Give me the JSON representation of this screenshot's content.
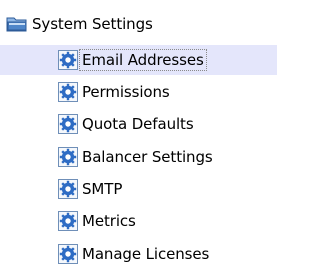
{
  "tree": {
    "root": {
      "label": "System Settings",
      "icon": "folder-icon"
    },
    "selected_index": 0,
    "items": [
      {
        "label": "Email Addresses",
        "icon": "settings-gear-icon"
      },
      {
        "label": "Permissions",
        "icon": "settings-gear-icon"
      },
      {
        "label": "Quota Defaults",
        "icon": "settings-gear-icon"
      },
      {
        "label": "Balancer Settings",
        "icon": "settings-gear-icon"
      },
      {
        "label": "SMTP",
        "icon": "settings-gear-icon"
      },
      {
        "label": "Metrics",
        "icon": "settings-gear-icon"
      },
      {
        "label": "Manage Licenses",
        "icon": "settings-gear-icon"
      }
    ],
    "colors": {
      "selected_background": "#e4e6fb",
      "icon_blue": "#2e6cc4",
      "folder_blue": "#4f86c9"
    }
  }
}
